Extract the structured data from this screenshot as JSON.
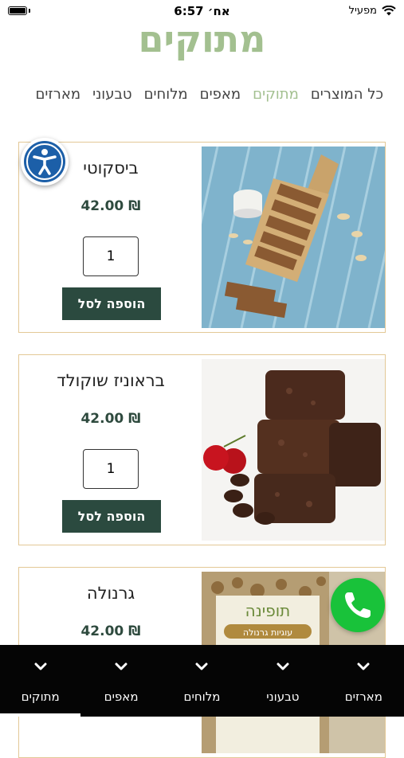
{
  "status_bar": {
    "time": "6:57 אח׳",
    "carrier": "מפעיל"
  },
  "page": {
    "title": "מתוקים"
  },
  "categories": [
    {
      "label": "כל המוצרים"
    },
    {
      "label": "מתוקים"
    },
    {
      "label": "מאפים"
    },
    {
      "label": "מלוחים"
    },
    {
      "label": "טבעוני"
    },
    {
      "label": "מארזים"
    }
  ],
  "categories_active": "מתוקים",
  "products": [
    {
      "name": "ביסקוטי",
      "price": "42.00 ₪",
      "quantity": "1",
      "add_label": "הוספה לסל"
    },
    {
      "name": "בראוניז שוקולד",
      "price": "42.00 ₪",
      "quantity": "1",
      "add_label": "הוספה לסל"
    },
    {
      "name": "גרנולה",
      "price": "42.00 ₪",
      "package_brand": "תופינה",
      "package_label": "עוגיות גרנולה"
    }
  ],
  "bottom_nav": [
    {
      "label": "מארזים"
    },
    {
      "label": "טבעוני"
    },
    {
      "label": "מלוחים"
    },
    {
      "label": "מאפים"
    },
    {
      "label": "מתוקים"
    }
  ],
  "bottom_nav_active": "מתוקים",
  "colors": {
    "title_green": "#a3c090",
    "button_green": "#2b4a3f",
    "card_border": "#e3c896",
    "call_green": "#19c23a",
    "accessibility_blue": "#1c5fa8"
  },
  "icons": {
    "accessibility": "accessibility-icon",
    "call": "phone-icon",
    "nav": "chevron-down-icon"
  }
}
